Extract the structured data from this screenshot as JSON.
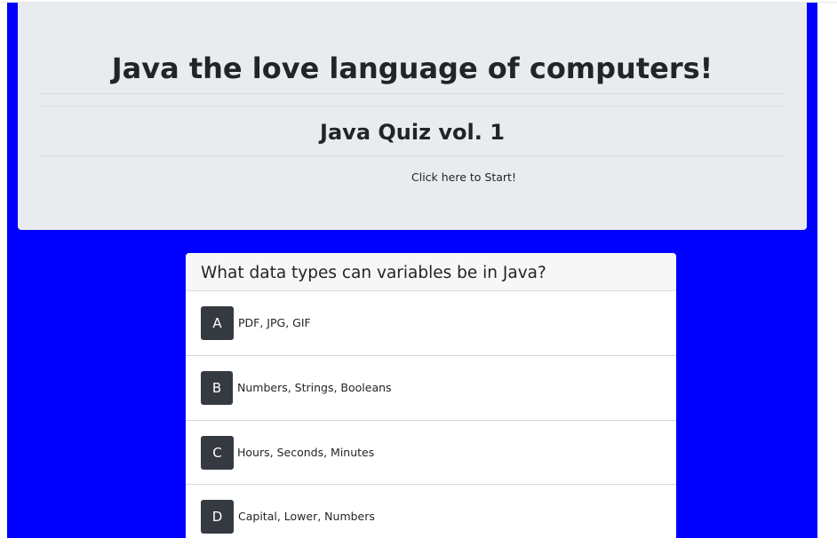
{
  "header": {
    "title": "Java the love language of computers!",
    "subtitle": "Java Quiz vol. 1",
    "start_link": "Click here to Start!"
  },
  "question": {
    "text": "What data types can variables be in Java?",
    "answers": [
      {
        "letter": "A",
        "text": "PDF, JPG, GIF"
      },
      {
        "letter": "B",
        "text": "Numbers, Strings, Booleans"
      },
      {
        "letter": "C",
        "text": "Hours, Seconds, Minutes"
      },
      {
        "letter": "D",
        "text": "Capital, Lower, Numbers"
      }
    ]
  },
  "colors": {
    "background": "#0000ff",
    "jumbotron": "#e9ecef",
    "answer_button": "#343a40"
  }
}
